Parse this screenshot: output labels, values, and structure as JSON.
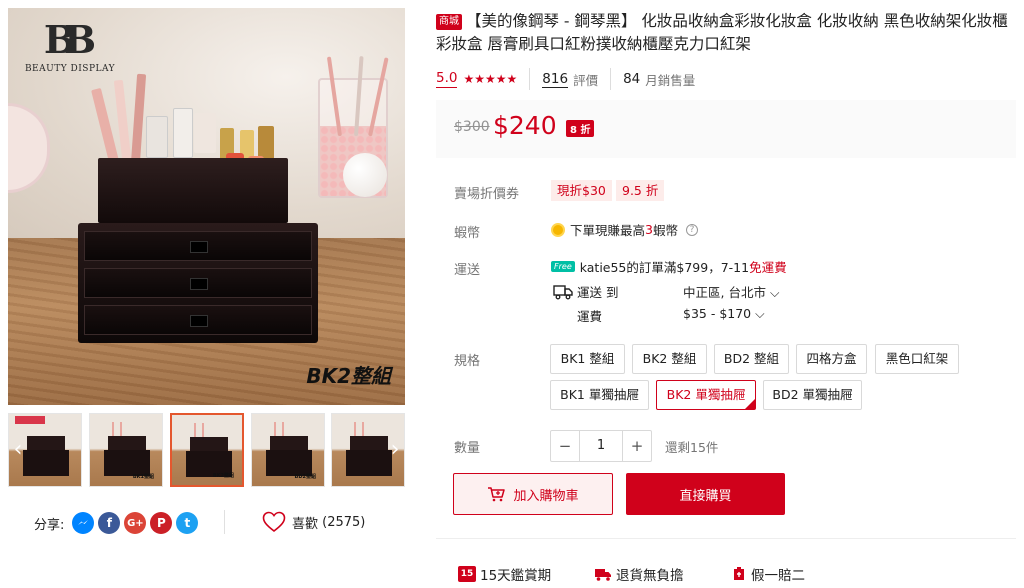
{
  "gallery": {
    "logo_text": "BEAUTY DISPLAY",
    "main_image_caption": "BK2整組",
    "thumb_captions": [
      "",
      "BK1整組",
      "BK2整組",
      "BD2整組",
      ""
    ],
    "active_thumb_index": 2
  },
  "share": {
    "label": "分享:",
    "icons": [
      "messenger-icon",
      "facebook-icon",
      "google-plus-icon",
      "pinterest-icon",
      "twitter-icon"
    ],
    "google_plus_glyph": "G+",
    "facebook_glyph": "f",
    "pinterest_glyph": "P",
    "twitter_glyph": "t"
  },
  "like": {
    "label": "喜歡",
    "count": "(2575)"
  },
  "product": {
    "mall_badge": "商城",
    "title": "【美的像鋼琴 - 鋼琴黑】 化妝品收納盒彩妝化妝盒 化妝收納 黑色收納架化妝櫃彩妝盒 唇膏刷具口紅粉撲收納櫃壓克力口紅架",
    "rating": "5.0",
    "stars": "★★★★★",
    "reviews_count": "816",
    "reviews_label": "評價",
    "sold_count": "84",
    "sold_label": "月銷售量"
  },
  "price": {
    "original": "$300",
    "current": "$240",
    "discount": "8 折"
  },
  "vouchers": {
    "label": "賣場折價券",
    "items": [
      "現折$30",
      "9.5 折"
    ]
  },
  "coins": {
    "label": "蝦幣",
    "text_prefix": "下單現賺最高",
    "amount": "3",
    "text_suffix": "蝦幣",
    "help": "?"
  },
  "shipping": {
    "label": "運送",
    "free_badge": "Free",
    "free_text_prefix": "katie55的訂單滿$799，7-11",
    "free_text_highlight": "免運費",
    "ship_to_label": "運送 到",
    "destination": "中正區, 台北市",
    "fee_label": "運費",
    "fee_range": "$35 - $170"
  },
  "variations": {
    "label": "規格",
    "options": [
      "BK1 整組",
      "BK2 整組",
      "BD2 整組",
      "四格方盒",
      "黑色口紅架",
      "BK1 單獨抽屜",
      "BK2 單獨抽屜",
      "BD2 單獨抽屜"
    ],
    "selected": "BK2 單獨抽屜"
  },
  "quantity": {
    "label": "數量",
    "value": "1",
    "minus": "−",
    "plus": "+",
    "stock_text": "還剩15件"
  },
  "actions": {
    "add_to_cart": "加入購物車",
    "buy_now": "直接購買"
  },
  "guarantees": [
    {
      "label": "15天鑑賞期",
      "icon": "calendar-icon"
    },
    {
      "label": "退貨無負擔",
      "icon": "return-truck-icon"
    },
    {
      "label": "假一賠二",
      "icon": "shield-icon"
    }
  ],
  "colors": {
    "brand_red": "#d0011b",
    "thumb_active_border": "#e4572e"
  }
}
